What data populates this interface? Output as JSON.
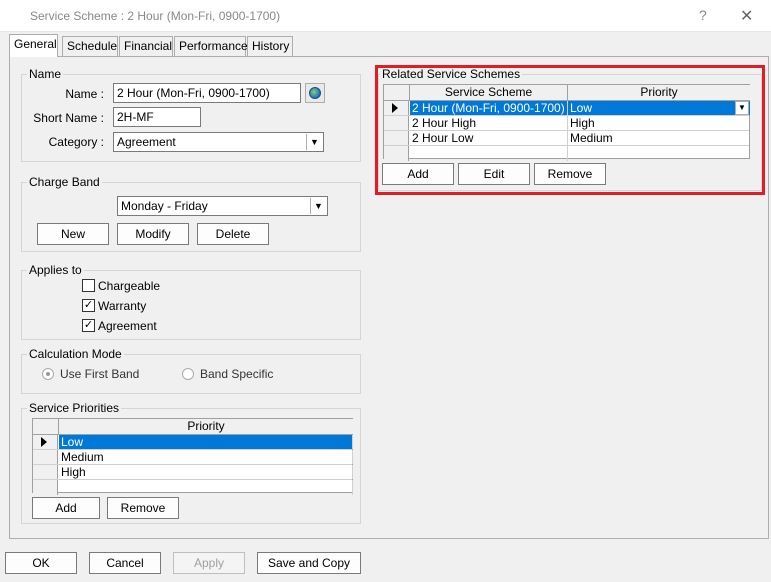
{
  "window": {
    "title": "Service Scheme : 2 Hour (Mon-Fri, 0900-1700)",
    "help_glyph": "?",
    "close_glyph": "✕"
  },
  "tabs": [
    "General",
    "Schedule",
    "Financial",
    "Performance",
    "History"
  ],
  "name_group": {
    "legend": "Name",
    "name_label": "Name :",
    "name_value": "2 Hour (Mon-Fri, 0900-1700)",
    "short_label": "Short Name :",
    "short_value": "2H-MF",
    "category_label": "Category :",
    "category_value": "Agreement"
  },
  "charge_band": {
    "legend": "Charge Band",
    "selected": "Monday - Friday",
    "new_label": "New",
    "modify_label": "Modify",
    "delete_label": "Delete"
  },
  "applies_to": {
    "legend": "Applies to",
    "items": [
      {
        "label": "Chargeable",
        "checked": false
      },
      {
        "label": "Warranty",
        "checked": true
      },
      {
        "label": "Agreement",
        "checked": true
      }
    ]
  },
  "calc_mode": {
    "legend": "Calculation Mode",
    "use_first": "Use First Band",
    "band_specific": "Band Specific"
  },
  "service_priorities": {
    "legend": "Service Priorities",
    "column": "Priority",
    "rows": [
      "Low",
      "Medium",
      "High"
    ],
    "add_label": "Add",
    "remove_label": "Remove"
  },
  "related": {
    "legend": "Related Service Schemes",
    "columns": [
      "Service Scheme",
      "Priority"
    ],
    "rows": [
      {
        "scheme": "2 Hour (Mon-Fri, 0900-1700)",
        "priority": "Low"
      },
      {
        "scheme": "2 Hour High",
        "priority": "High"
      },
      {
        "scheme": "2 Hour Low",
        "priority": "Medium"
      }
    ],
    "add_label": "Add",
    "edit_label": "Edit",
    "remove_label": "Remove"
  },
  "footer": {
    "ok": "OK",
    "cancel": "Cancel",
    "apply": "Apply",
    "save_copy": "Save and Copy"
  },
  "colors": {
    "selection": "#0078d7",
    "highlight_box": "#e31b23"
  }
}
